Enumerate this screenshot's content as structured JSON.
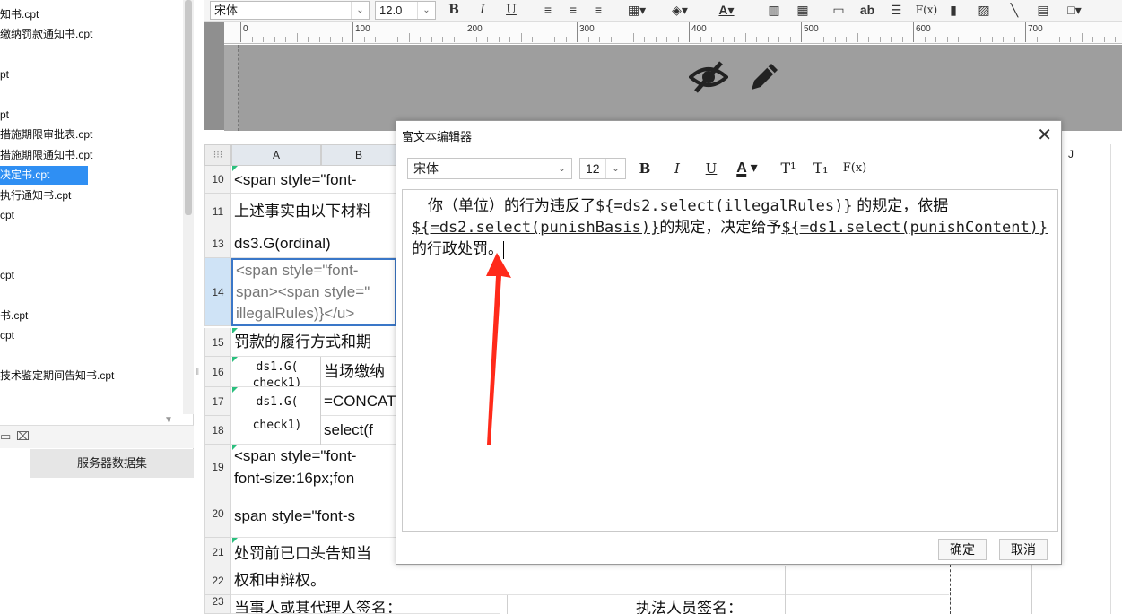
{
  "file_list": {
    "items": [
      {
        "label": "知书.cpt",
        "selected": false
      },
      {
        "label": "缴纳罚款通知书.cpt",
        "selected": false
      },
      {
        "label": "",
        "selected": false
      },
      {
        "label": "pt",
        "selected": false
      },
      {
        "label": "",
        "selected": false
      },
      {
        "label": "pt",
        "selected": false
      },
      {
        "label": "措施期限审批表.cpt",
        "selected": false
      },
      {
        "label": "措施期限通知书.cpt",
        "selected": false
      },
      {
        "label": "决定书.cpt",
        "selected": true
      },
      {
        "label": "执行通知书.cpt",
        "selected": false
      },
      {
        "label": "cpt",
        "selected": false
      },
      {
        "label": "",
        "selected": false
      },
      {
        "label": "",
        "selected": false
      },
      {
        "label": "cpt",
        "selected": false
      },
      {
        "label": "",
        "selected": false
      },
      {
        "label": "书.cpt",
        "selected": false
      },
      {
        "label": "cpt",
        "selected": false
      },
      {
        "label": "",
        "selected": false
      },
      {
        "label": "技术鉴定期间告知书.cpt",
        "selected": false
      }
    ],
    "server_dataset_tab": "服务器数据集"
  },
  "toolbar": {
    "font_name": "宋体",
    "font_size": "12.0",
    "bold": "B",
    "italic": "I",
    "underline": "U",
    "text_ab": "ab",
    "formula": "F(x)"
  },
  "ruler": {
    "ticks": [
      "0",
      "100",
      "200",
      "300",
      "400",
      "500",
      "600",
      "700"
    ]
  },
  "grid": {
    "corner": "⁝⁝⁝",
    "columns": [
      "A",
      "B",
      "J"
    ],
    "rows": [
      {
        "num": "10",
        "a": "<span style=\"font-"
      },
      {
        "num": "11",
        "a": "上述事实由以下材料"
      },
      {
        "num": "13",
        "a": "ds3.G(ordinal)"
      },
      {
        "num": "14",
        "a1": "<span style=\"font-",
        "a2": "span><span style=\"",
        "a3": "illegalRules)}</u>"
      },
      {
        "num": "15",
        "a": "罚款的履行方式和期"
      },
      {
        "num": "16",
        "a": "ds1.G(",
        "a_extra": "check1)",
        "b": "当场缴纳"
      },
      {
        "num": "17",
        "a": "ds1.G(",
        "a_extra": "check1)",
        "b": "=CONCATE"
      },
      {
        "num": "18",
        "b": "select(f"
      },
      {
        "num": "19",
        "a": "<span style=\"font-",
        "a2": "font-size:16px;fon"
      },
      {
        "num": "20",
        "a": "span style=\"font-s"
      },
      {
        "num": "21",
        "a": "处罚前已口头告知当"
      },
      {
        "num": "22",
        "a": "权和申辩权。"
      },
      {
        "num": "23",
        "a": "当事人或其代理人签名：",
        "c": "执法人员签名："
      }
    ]
  },
  "dialog": {
    "title": "富文本编辑器",
    "font_name": "宋体",
    "font_size": "12",
    "bold": "B",
    "italic": "I",
    "underline": "U",
    "superscript": "T¹",
    "subscript": "T₁",
    "formula": "F(x)",
    "content": {
      "t1": "你（单位）的行为违反了",
      "e1": "${=ds2.select(illegalRules)}",
      "t2": " 的规定，依据",
      "e2": "${=ds2.select(punishBasis)}",
      "t3": "的规定，决定给予",
      "e3": "${=ds1.select(punishContent)}",
      "t4": "的行政处罚。"
    },
    "ok_label": "确定",
    "cancel_label": "取消"
  },
  "colors": {
    "selected_file": "#2f8ff3",
    "header_band": "#9e9e9e",
    "annotation_arrow": "#ff2a1a",
    "active_row": "#cfe3f6",
    "cell_marker": "#2bbf7e"
  }
}
